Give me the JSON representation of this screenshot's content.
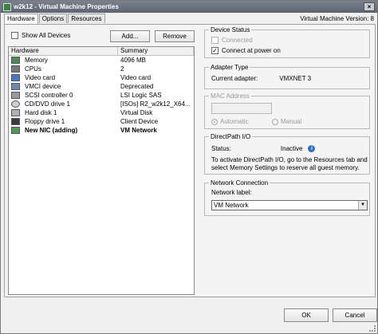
{
  "window": {
    "title": "w2k12 - Virtual Machine Properties",
    "close_label": "×"
  },
  "tabs": [
    {
      "label": "Hardware"
    },
    {
      "label": "Options"
    },
    {
      "label": "Resources"
    }
  ],
  "vm_version": "Virtual Machine Version: 8",
  "hardware": {
    "show_all_label": "Show All Devices",
    "add_label": "Add...",
    "remove_label": "Remove",
    "columns": [
      "Hardware",
      "Summary"
    ],
    "rows": [
      {
        "name": "Memory",
        "summary": "4096 MB",
        "icon": "memory-icon"
      },
      {
        "name": "CPUs",
        "summary": "2",
        "icon": "cpu-icon"
      },
      {
        "name": "Video card",
        "summary": "Video card",
        "icon": "video-card-icon"
      },
      {
        "name": "VMCI device",
        "summary": "Deprecated",
        "icon": "vmci-device-icon"
      },
      {
        "name": "SCSI controller 0",
        "summary": "LSI Logic SAS",
        "icon": "scsi-controller-icon"
      },
      {
        "name": "CD/DVD drive 1",
        "summary": "[ISOs] R2_w2k12_X64...",
        "icon": "cd-dvd-icon"
      },
      {
        "name": "Hard disk 1",
        "summary": "Virtual Disk",
        "icon": "hard-disk-icon"
      },
      {
        "name": "Floppy drive 1",
        "summary": "Client Device",
        "icon": "floppy-icon"
      },
      {
        "name": "New NIC (adding)",
        "summary": "VM Network",
        "icon": "network-adapter-icon"
      }
    ]
  },
  "device_status": {
    "legend": "Device Status",
    "connected_label": "Connected",
    "connect_power_label": "Connect at power on",
    "check_mark": "✓"
  },
  "adapter_type": {
    "legend": "Adapter Type",
    "current_label": "Current adapter:",
    "current_value": "VMXNET 3"
  },
  "mac_address": {
    "legend": "MAC Address",
    "automatic_label": "Automatic",
    "manual_label": "Manual"
  },
  "directpath": {
    "legend": "DirectPath I/O",
    "status_label": "Status:",
    "status_value": "Inactive",
    "info_glyph": "i",
    "note": "To activate DirectPath I/O, go to the Resources tab and select Memory Settings to reserve all guest memory."
  },
  "network_connection": {
    "legend": "Network Connection",
    "label": "Network label:",
    "value": "VM Network",
    "arrow": "▼"
  },
  "footer": {
    "ok_label": "OK",
    "cancel_label": "Cancel"
  }
}
